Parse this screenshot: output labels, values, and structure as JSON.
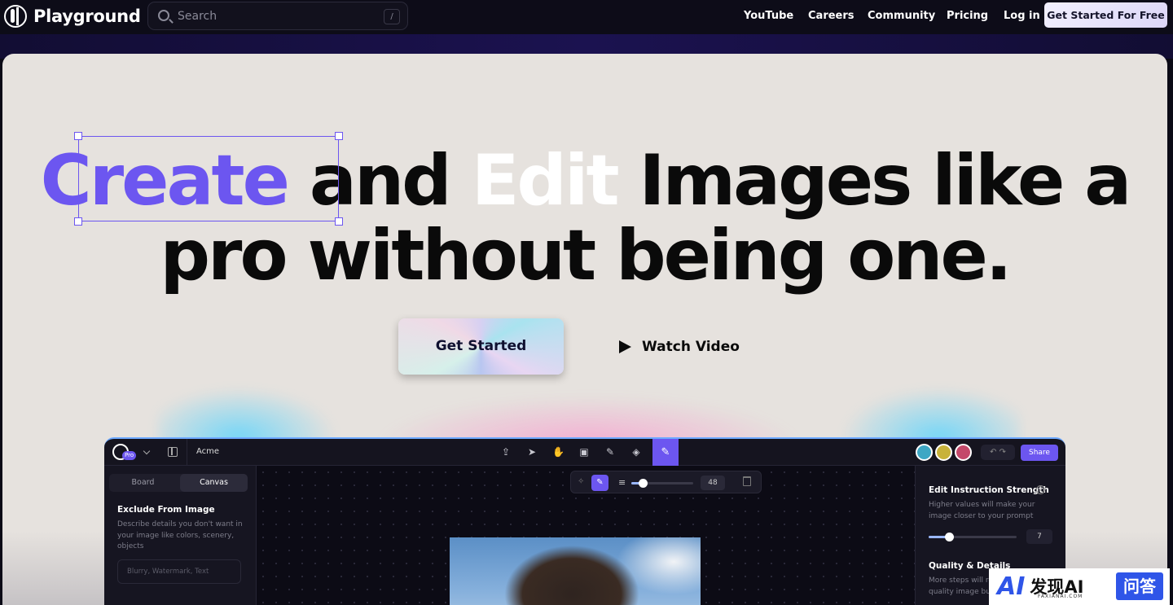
{
  "nav": {
    "brand": "Playground",
    "search_placeholder": "Search",
    "search_shortcut": "/",
    "links": [
      "YouTube",
      "Careers",
      "Community",
      "Pricing",
      "Log in"
    ],
    "cta": "Get Started For Free"
  },
  "hero": {
    "word_create": "Create",
    "word_and": " and ",
    "word_edit": "Edit",
    "rest_line1": " Images like a",
    "line2": "pro without being one.",
    "primary_button": "Get Started",
    "video_button": "Watch Video"
  },
  "app": {
    "plan_badge": "Pro",
    "project_name": "Acme",
    "share_label": "Share",
    "tabs": [
      "Board",
      "Canvas"
    ],
    "active_tab": "Canvas",
    "exclude_title": "Exclude From Image",
    "exclude_desc": "Describe details you don't want in your image like colors, scenery, objects",
    "exclude_placeholder": "Blurry, Watermark, Text",
    "brush_size": "48",
    "brush_size_fraction": 0.18,
    "edit_strength_title": "Edit Instruction Strength",
    "edit_strength_desc": "Higher values will make your image closer to your prompt",
    "edit_strength_value": "7",
    "edit_strength_fraction": 0.23,
    "quality_title": "Quality & Details",
    "quality_desc": "More steps will result in a higher quality image but"
  },
  "watermark": {
    "logo_text": "AI",
    "brand_cn": "发现AI",
    "brand_sub": "FAXIANAI.COM",
    "box_text": "问答"
  },
  "colors": {
    "accent": "#6c56f0",
    "hero_bg": "#e6e2de",
    "nav_bg": "#0d0c18"
  }
}
